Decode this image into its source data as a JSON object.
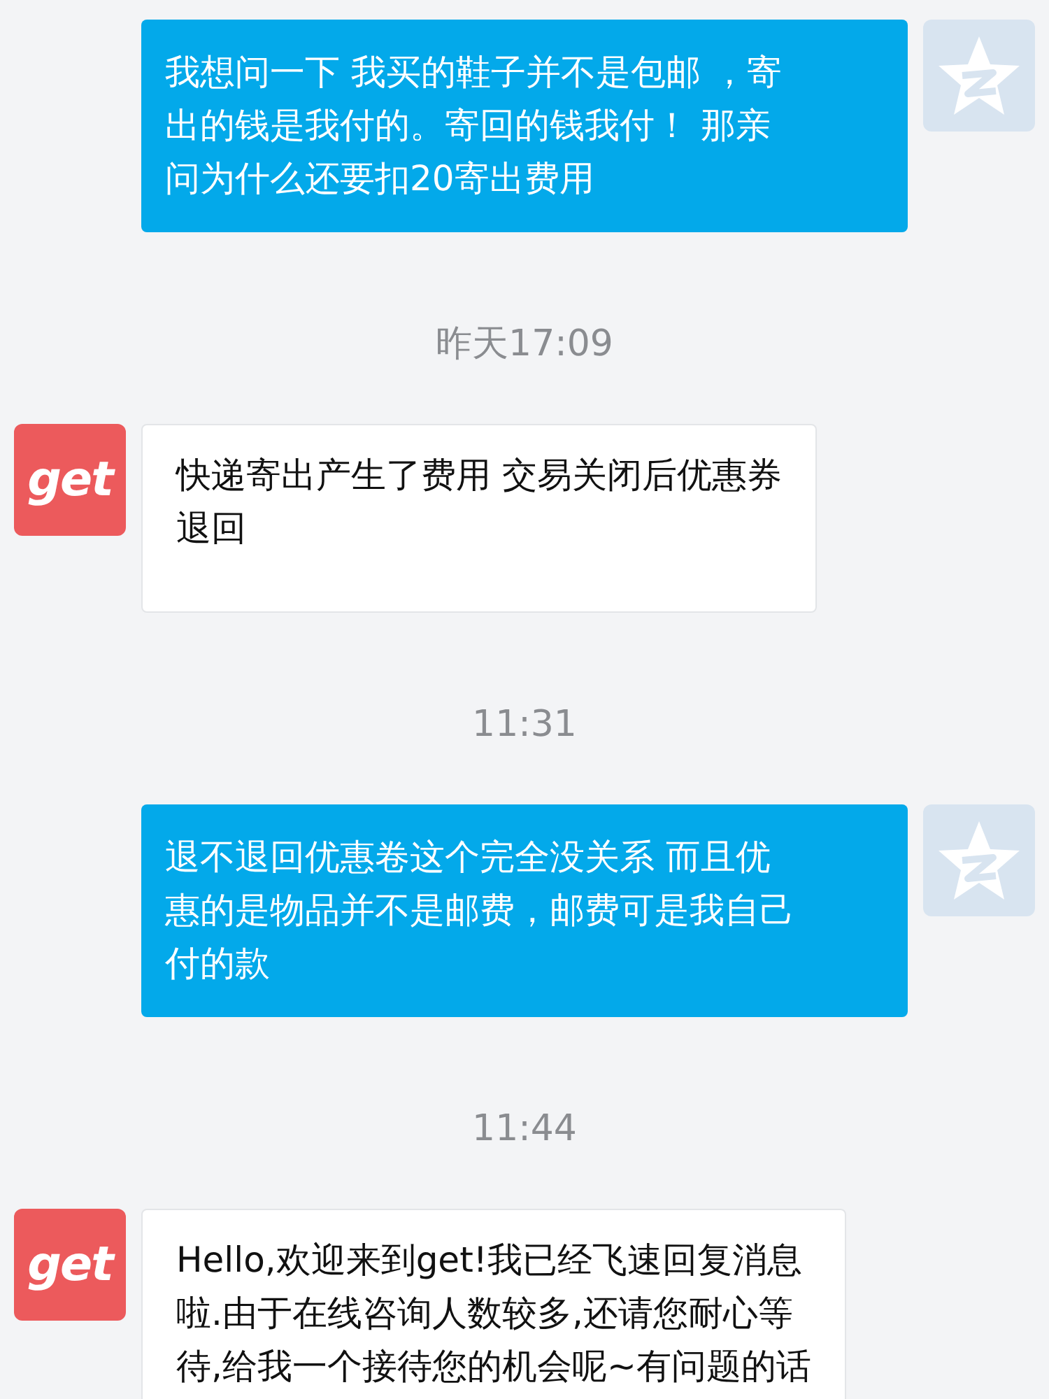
{
  "messages": [
    {
      "kind": "sent",
      "lines": [
        "我想问一下 我买的鞋子并不是包邮 ，寄",
        "出的钱是我付的。寄回的钱我付！ 那亲",
        "问为什么还要扣20寄出费用"
      ]
    },
    {
      "kind": "time",
      "text": "昨天17:09"
    },
    {
      "kind": "received",
      "avatar_text": "get",
      "lines": [
        "快递寄出产生了费用 交易关闭后优惠券",
        "退回"
      ]
    },
    {
      "kind": "time",
      "text": "11:31"
    },
    {
      "kind": "sent",
      "lines": [
        "退不退回优惠卷这个完全没关系  而且优",
        "惠的是物品并不是邮费，邮费可是我自己",
        "付的款"
      ]
    },
    {
      "kind": "time",
      "text": "11:44"
    },
    {
      "kind": "received",
      "avatar_text": "get",
      "lines": [
        "Hello,欢迎来到get!我已经飞速回复消息",
        "啦.由于在线咨询人数较多,还请您耐心等",
        "待,给我一个接待您的机会呢~有问题的话"
      ]
    }
  ]
}
